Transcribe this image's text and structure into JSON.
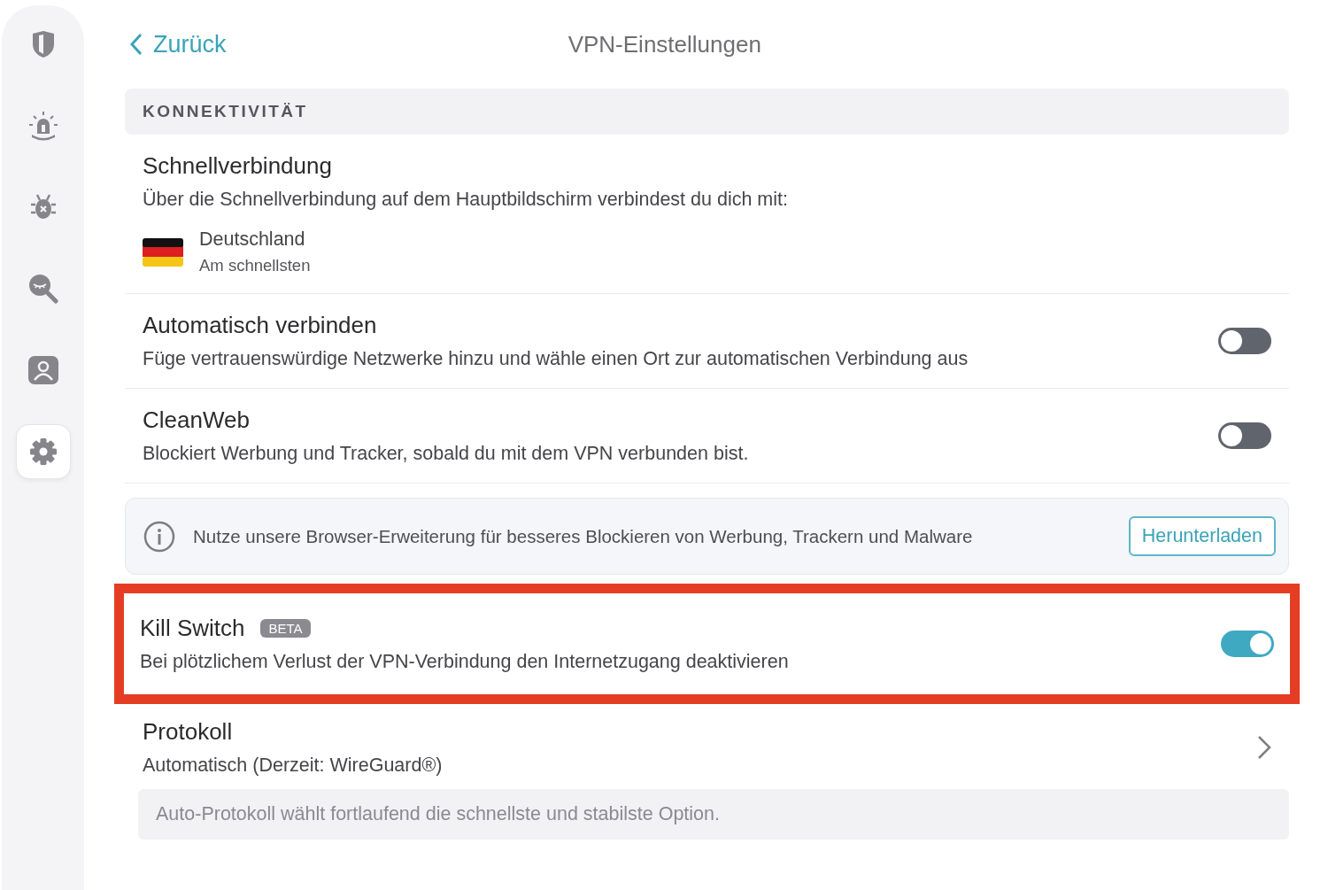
{
  "sidebar": {
    "items": [
      {
        "selected": false
      },
      {
        "selected": false
      },
      {
        "selected": false
      },
      {
        "selected": false
      },
      {
        "selected": false
      },
      {
        "selected": true
      }
    ]
  },
  "header": {
    "back": "Zurück",
    "title": "VPN-Einstellungen"
  },
  "section": {
    "title": "KONNEKTIVITÄT"
  },
  "rows": [
    {
      "kind": "quick",
      "title": "Schnellverbindung",
      "description": "Über die Schnellverbindung auf dem Hauptbildschirm verbindest du dich mit:",
      "country": "Deutschland",
      "subtitle": "Am schnellsten"
    },
    {
      "kind": "toggle",
      "title": "Automatisch verbinden",
      "description": "Füge vertrauenswürdige Netzwerke hinzu und wähle einen Ort zur automatischen Verbindung aus",
      "on": false,
      "highlighted": false
    },
    {
      "kind": "toggle",
      "title": "CleanWeb",
      "description": "Blockiert Werbung und Tracker, sobald du mit dem VPN verbunden bist.",
      "on": false,
      "highlighted": false
    },
    {
      "kind": "info",
      "text": "Nutze unsere Browser-Erweiterung für besseres Blockieren von Werbung, Trackern und Malware",
      "button": "Herunterladen"
    },
    {
      "kind": "toggle",
      "title": "Kill Switch",
      "badge": "BETA",
      "description": "Bei plötzlichem Verlust der VPN-Verbindung den Internetzugang deaktivieren",
      "on": true,
      "highlighted": true
    },
    {
      "kind": "link",
      "title": "Protokoll",
      "description": "Automatisch (Derzeit: WireGuard®)",
      "note": "Auto-Protokoll wählt fortlaufend die schnellste und stabilste Option."
    }
  ]
}
